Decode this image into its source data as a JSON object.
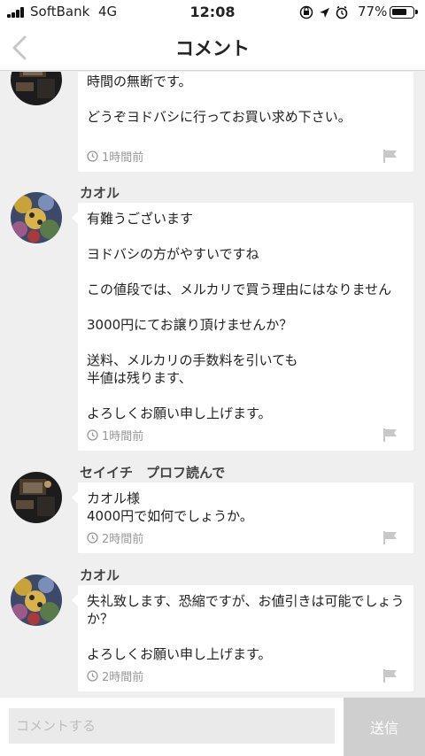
{
  "status_bar": {
    "carrier": "SoftBank",
    "network": "4G",
    "time": "12:08",
    "battery": "77%",
    "battery_level": 0.77
  },
  "nav": {
    "title": "コメント"
  },
  "comments": [
    {
      "author": "",
      "text": "最初から希望の値段があるならお伝え下さい。\n時間の無断です。\n\nどうぞヨドバシに行ってお買い求め下さい。",
      "time": "1時間前",
      "avatar": "seller-avatar"
    },
    {
      "author": "カオル",
      "text": "有難うございます\n\nヨドバシの方がやすいですね\n\nこの値段では、メルカリで買う理由にはなりません\n\n3000円にてお譲り頂けませんか？\n\n送料、メルカリの手数料を引いても\n半値は残ります、\n\nよろしくお願い申し上げます。",
      "time": "1時間前",
      "avatar": "buyer-avatar"
    },
    {
      "author": "セイイチ　プロフ読んで",
      "text": "カオル様\n4000円で如何でしょうか。",
      "time": "2時間前",
      "avatar": "seller-avatar"
    },
    {
      "author": "カオル",
      "text": "失礼致します、恐縮ですが、お値引きは可能でしょうか？\n\nよろしくお願い申し上げます。",
      "time": "2時間前",
      "avatar": "buyer-avatar"
    }
  ],
  "input": {
    "placeholder": "コメントする",
    "send_label": "送信"
  },
  "colors": {
    "background": "#efefef",
    "bubble": "#ffffff",
    "send_button": "#cfcfcf",
    "meta_text": "#999999"
  }
}
